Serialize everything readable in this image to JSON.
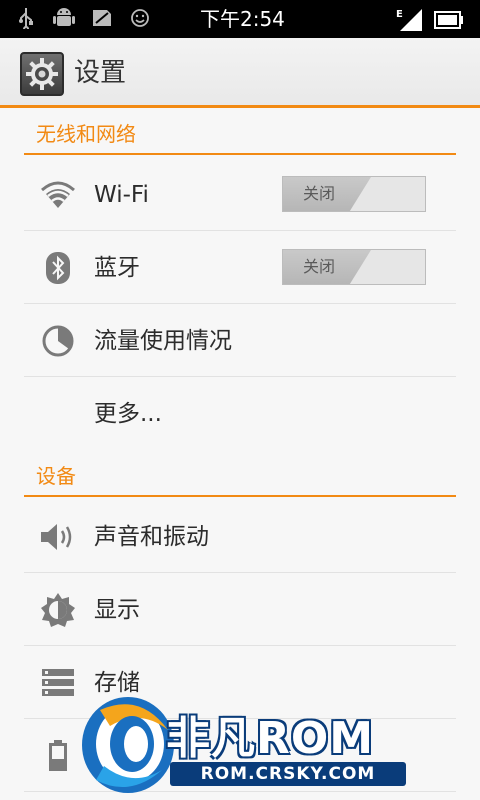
{
  "status_bar": {
    "time": "下午2:54",
    "left_icons": [
      "usb-icon",
      "android-debug-icon",
      "sd-card-icon",
      "smiley-icon"
    ],
    "right_icons": [
      "edge-signal-icon",
      "battery-icon"
    ]
  },
  "action_bar": {
    "title": "设置",
    "accent": "#f28a14"
  },
  "sections": [
    {
      "header": "无线和网络",
      "items": [
        {
          "label": "Wi-Fi",
          "icon": "wifi-icon",
          "toggle": "关闭"
        },
        {
          "label": "蓝牙",
          "icon": "bluetooth-icon",
          "toggle": "关闭"
        },
        {
          "label": "流量使用情况",
          "icon": "data-usage-icon"
        },
        {
          "label": "更多..."
        }
      ]
    },
    {
      "header": "设备",
      "items": [
        {
          "label": "声音和振动",
          "icon": "speaker-icon"
        },
        {
          "label": "显示",
          "icon": "brightness-icon"
        },
        {
          "label": "存储",
          "icon": "storage-icon"
        },
        {
          "label": "",
          "icon": "battery-icon"
        }
      ]
    }
  ],
  "watermark": {
    "brand": "非凡ROM",
    "url": "ROM.CRSKY.COM"
  }
}
